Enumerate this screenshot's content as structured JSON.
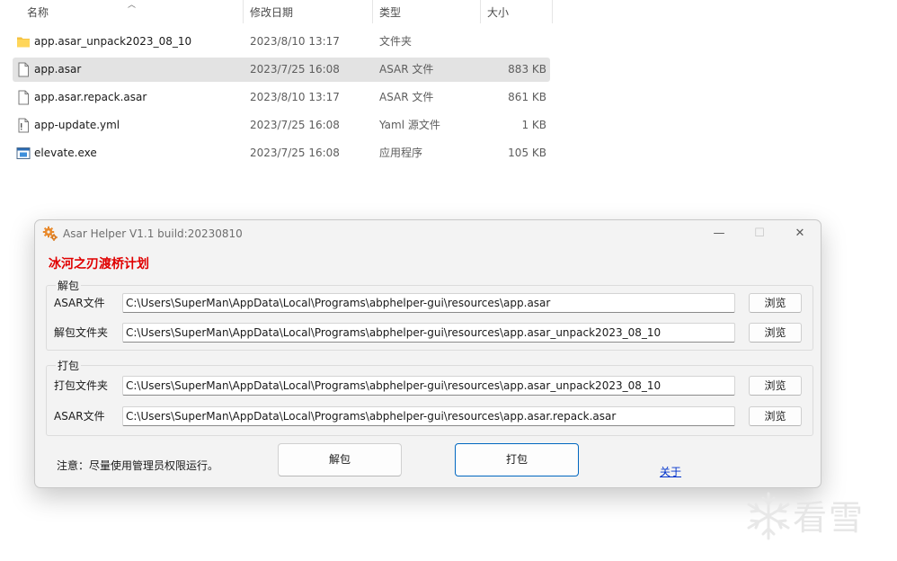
{
  "explorer": {
    "columns": {
      "name": "名称",
      "modified": "修改日期",
      "type": "类型",
      "size": "大小"
    },
    "files": [
      {
        "icon": "folder-icon",
        "name": "app.asar_unpack2023_08_10",
        "modified": "2023/8/10 13:17",
        "type": "文件夹",
        "size": ""
      },
      {
        "icon": "file-icon",
        "name": "app.asar",
        "modified": "2023/7/25 16:08",
        "type": "ASAR 文件",
        "size": "883 KB"
      },
      {
        "icon": "file-icon",
        "name": "app.asar.repack.asar",
        "modified": "2023/8/10 13:17",
        "type": "ASAR 文件",
        "size": "861 KB"
      },
      {
        "icon": "yaml-icon",
        "name": "app-update.yml",
        "modified": "2023/7/25 16:08",
        "type": "Yaml 源文件",
        "size": "1 KB"
      },
      {
        "icon": "exe-icon",
        "name": "elevate.exe",
        "modified": "2023/7/25 16:08",
        "type": "应用程序",
        "size": "105 KB"
      }
    ],
    "selected_index": 1
  },
  "dialog": {
    "title": "Asar Helper V1.1 build:20230810",
    "heading": "冰河之刃渡桥计划",
    "heading_color": "#e00000",
    "unpack_group": {
      "title": "解包",
      "asar_label": "ASAR文件",
      "asar_path": "C:\\Users\\SuperMan\\AppData\\Local\\Programs\\abphelper-gui\\resources\\app.asar",
      "folder_label": "解包文件夹",
      "folder_path": "C:\\Users\\SuperMan\\AppData\\Local\\Programs\\abphelper-gui\\resources\\app.asar_unpack2023_08_10",
      "browse_label": "浏览"
    },
    "pack_group": {
      "title": "打包",
      "folder_label": "打包文件夹",
      "folder_path": "C:\\Users\\SuperMan\\AppData\\Local\\Programs\\abphelper-gui\\resources\\app.asar_unpack2023_08_10",
      "asar_label": "ASAR文件",
      "asar_path": "C:\\Users\\SuperMan\\AppData\\Local\\Programs\\abphelper-gui\\resources\\app.asar.repack.asar",
      "browse_label": "浏览"
    },
    "note": "注意：尽量使用管理员权限运行。",
    "unpack_button": "解包",
    "pack_button": "打包",
    "about_link": "关于"
  },
  "watermark": {
    "text": "看雪"
  }
}
